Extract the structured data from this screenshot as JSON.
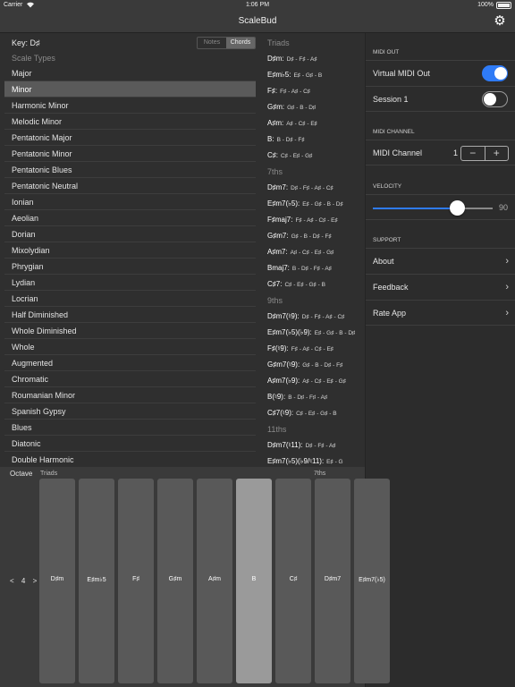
{
  "status": {
    "carrier": "Carrier",
    "time": "1:06 PM",
    "battery": "100%"
  },
  "nav": {
    "title": "ScaleBud",
    "settings_icon": "gear-icon"
  },
  "scales": {
    "key_label": "Key: D♯",
    "segment": [
      "Notes",
      "Chords"
    ],
    "segment_selected": "Chords",
    "header": "Scale Types",
    "selected": "Minor",
    "items": [
      "Major",
      "Minor",
      "Harmonic Minor",
      "Melodic Minor",
      "Pentatonic Major",
      "Pentatonic Minor",
      "Pentatonic Blues",
      "Pentatonic Neutral",
      "Ionian",
      "Aeolian",
      "Dorian",
      "Mixolydian",
      "Phrygian",
      "Lydian",
      "Locrian",
      "Half Diminished",
      "Whole Diminished",
      "Whole",
      "Augmented",
      "Chromatic",
      "Roumanian Minor",
      "Spanish Gypsy",
      "Blues",
      "Diatonic",
      "Double Harmonic"
    ]
  },
  "chords": {
    "sections": [
      {
        "title": "Triads",
        "rows": [
          {
            "name": "D♯m:",
            "notes": "D♯ - F♯ - A♯"
          },
          {
            "name": "E♯m♭5:",
            "notes": "E♯ - G♯ - B"
          },
          {
            "name": "F♯:",
            "notes": "F♯ - A♯ - C♯"
          },
          {
            "name": "G♯m:",
            "notes": "G♯ - B - D♯"
          },
          {
            "name": "A♯m:",
            "notes": "A♯ - C♯ - E♯"
          },
          {
            "name": "B:",
            "notes": "B - D♯ - F♯"
          },
          {
            "name": "C♯:",
            "notes": "C♯ - E♯ - G♯"
          }
        ]
      },
      {
        "title": "7ths",
        "rows": [
          {
            "name": "D♯m7:",
            "notes": "D♯ - F♯ - A♯ - C♯"
          },
          {
            "name": "E♯m7(♭5):",
            "notes": "E♯ - G♯ - B - D♯"
          },
          {
            "name": "F♯maj7:",
            "notes": "F♯ - A♯ - C♯ - E♯"
          },
          {
            "name": "G♯m7:",
            "notes": "G♯ - B - D♯ - F♯"
          },
          {
            "name": "A♯m7:",
            "notes": "A♯ - C♯ - E♯ - G♯"
          },
          {
            "name": "Bmaj7:",
            "notes": "B - D♯ - F♯ - A♯"
          },
          {
            "name": "C♯7:",
            "notes": "C♯ - E♯ - G♯ - B"
          }
        ]
      },
      {
        "title": "9ths",
        "rows": [
          {
            "name": "D♯m7(♮9):",
            "notes": "D♯ - F♯ - A♯ - C♯"
          },
          {
            "name": "E♯m7(♭5)(♭9):",
            "notes": "E♯ - G♯ - B - D♯"
          },
          {
            "name": "F♯(♮9):",
            "notes": "F♯ - A♯ - C♯ - E♯"
          },
          {
            "name": "G♯m7(♮9):",
            "notes": "G♯ - B - D♯ - F♯"
          },
          {
            "name": "A♯m7(♭9):",
            "notes": "A♯ - C♯ - E♯ - G♯"
          },
          {
            "name": "B(♮9):",
            "notes": "B - D♯ - F♯ - A♯"
          },
          {
            "name": "C♯7(♮9):",
            "notes": "C♯ - E♯ - G♯ - B"
          }
        ]
      },
      {
        "title": "11ths",
        "rows": [
          {
            "name": "D♯m7(♮11):",
            "notes": "D♯ - F♯ - A♯"
          },
          {
            "name": "E♯m7(♭5)(♭9/♮11):",
            "notes": "E♯ - G"
          }
        ]
      }
    ]
  },
  "settings": {
    "midi_out": {
      "header": "MIDI OUT",
      "virtual_label": "Virtual MIDI Out",
      "virtual_on": true,
      "session_label": "Session 1",
      "session_on": false
    },
    "midi_channel": {
      "header": "MIDI CHANNEL",
      "label": "MIDI Channel",
      "value": "1",
      "minus": "−",
      "plus": "+"
    },
    "velocity": {
      "header": "VELOCITY",
      "value": "90",
      "fraction": 0.7
    },
    "support": {
      "header": "SUPPORT",
      "items": [
        "About",
        "Feedback",
        "Rate App"
      ]
    }
  },
  "keyboard": {
    "octave_label": "Octave",
    "octave_control": "< 4 >",
    "triads_label": "Triads",
    "sevenths_label": "7ths",
    "active_pad": "B",
    "pads": [
      "D♯m",
      "E♯m♭5",
      "F♯",
      "G♯m",
      "A♯m",
      "B",
      "C♯",
      "D♯m7",
      "E♯m7(♭5)"
    ]
  }
}
